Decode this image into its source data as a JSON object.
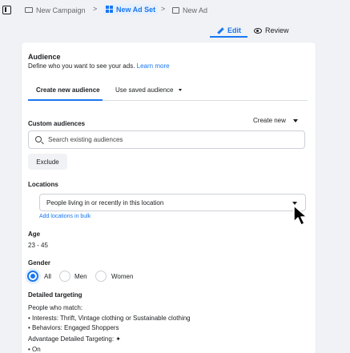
{
  "breadcrumb": {
    "campaign": "New Campaign",
    "adset": "New Ad Set",
    "ad": "New Ad",
    "separator": ">"
  },
  "mode_tabs": {
    "edit": "Edit",
    "review": "Review"
  },
  "audience": {
    "title": "Audience",
    "description": "Define who you want to see your ads.",
    "learn_more": "Learn more",
    "tabs": {
      "create_new": "Create new audience",
      "use_saved": "Use saved audience"
    },
    "custom_audiences": {
      "label": "Custom audiences",
      "create_new": "Create new",
      "search_placeholder": "Search existing audiences",
      "exclude_button": "Exclude"
    },
    "locations": {
      "label": "Locations",
      "selected": "People living in or recently in this location",
      "add_bulk": "Add locations in bulk"
    },
    "age": {
      "label": "Age",
      "value": "23 - 45"
    },
    "gender": {
      "label": "Gender",
      "options": [
        "All",
        "Men",
        "Women"
      ],
      "selected": "All"
    },
    "detailed_targeting": {
      "label": "Detailed targeting",
      "people_who_match": "People who match:",
      "items": [
        "Interests: Thrift, Vintage clothing or Sustainable clothing",
        "Behaviors: Engaged Shoppers"
      ],
      "advantage_label": "Advantage Detailed Targeting:",
      "advantage_value": "On"
    }
  },
  "colors": {
    "accent": "#1877f2",
    "background": "#f0f2f5",
    "card": "#ffffff",
    "text": "#1c1e21",
    "muted": "#65676b"
  }
}
